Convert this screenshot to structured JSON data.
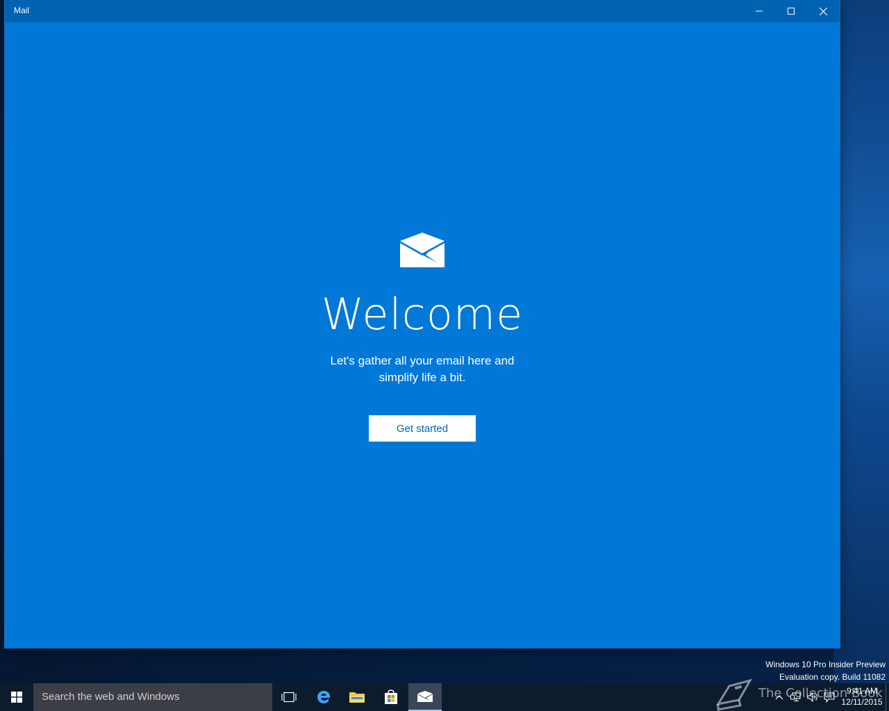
{
  "window": {
    "title": "Mail"
  },
  "welcome": {
    "heading": "Welcome",
    "subtitle_line1": "Let's gather all your email here and",
    "subtitle_line2": "simplify life a bit.",
    "button_label": "Get started"
  },
  "watermark": {
    "line1": "Windows 10 Pro Insider Preview",
    "line2": "Evaluation copy. Build 11082",
    "overlay_text": "The Collection Book"
  },
  "taskbar": {
    "search_placeholder": "Search the web and Windows",
    "pinned": [
      "task-view",
      "edge",
      "file-explorer",
      "store",
      "mail"
    ],
    "active_app": "mail",
    "clock_time": "9:41 AM",
    "clock_date": "12/11/2015"
  },
  "colors": {
    "app_accent": "#0078d7",
    "titlebar": "#0063b1",
    "taskbar": "#0d1b2e",
    "search_box": "#3b3f45"
  }
}
